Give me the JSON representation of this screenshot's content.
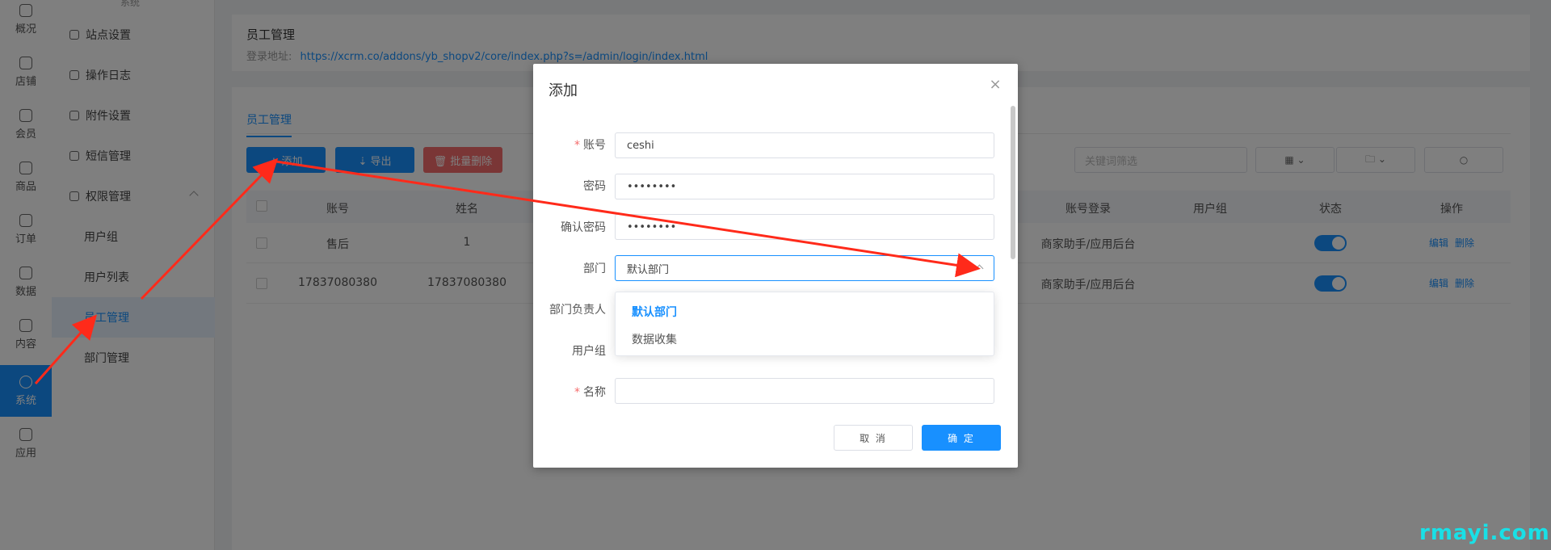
{
  "rail": {
    "items": [
      {
        "label": "概况",
        "icon": "dashboard-icon"
      },
      {
        "label": "店铺",
        "icon": "shop-icon"
      },
      {
        "label": "会员",
        "icon": "member-icon"
      },
      {
        "label": "商品",
        "icon": "goods-icon"
      },
      {
        "label": "订单",
        "icon": "order-icon"
      },
      {
        "label": "数据",
        "icon": "data-icon"
      },
      {
        "label": "内容",
        "icon": "content-icon"
      },
      {
        "label": "系统",
        "icon": "system-gear-icon"
      },
      {
        "label": "应用",
        "icon": "app-icon"
      }
    ],
    "active": "系统"
  },
  "submenu": {
    "top_label": "系统",
    "items": [
      {
        "label": "站点设置",
        "icon": "site-icon"
      },
      {
        "label": "操作日志",
        "icon": "log-icon"
      },
      {
        "label": "附件设置",
        "icon": "attachment-icon"
      },
      {
        "label": "短信管理",
        "icon": "sms-icon"
      },
      {
        "label": "权限管理",
        "icon": "permission-icon"
      },
      {
        "label": "用户组"
      },
      {
        "label": "用户列表"
      },
      {
        "label": "员工管理"
      },
      {
        "label": "部门管理"
      }
    ],
    "active": "员工管理"
  },
  "header": {
    "title": "员工管理",
    "url_label": "登录地址:",
    "url": "https://xcrm.co/addons/yb_shopv2/core/index.php?s=/admin/login/index.html"
  },
  "main": {
    "tab": "员工管理",
    "toolbar": {
      "add_label": "+ 添加",
      "export_label": "⇣ 导出",
      "batch_delete_label": "🗑 批量删除",
      "search_placeholder": "关键词筛选",
      "grid_label": "▦ ⌄",
      "folder_label": "🗀 ⌄",
      "search_icon_label": "○"
    },
    "table": {
      "columns": [
        "账号",
        "姓名",
        "账号登录",
        "用户组",
        "状态",
        "操作"
      ],
      "rows": [
        {
          "account": "售后",
          "name": "1",
          "login": "商家助手/应用后台",
          "group": "",
          "status": "on",
          "ops": [
            "编辑",
            "删除"
          ]
        },
        {
          "account": "17837080380",
          "name": "17837080380",
          "login": "商家助手/应用后台",
          "group": "",
          "status": "on",
          "ops": [
            "编辑",
            "删除"
          ]
        }
      ]
    }
  },
  "modal": {
    "title": "添加",
    "close": "×",
    "fields": {
      "account": {
        "label": "账号",
        "required": true,
        "value": "ceshi"
      },
      "password": {
        "label": "密码",
        "value": "••••••••"
      },
      "confirm_password": {
        "label": "确认密码",
        "value": "••••••••"
      },
      "department": {
        "label": "部门",
        "value": "默认部门"
      },
      "dept_leader": {
        "label": "部门负责人"
      },
      "user_group": {
        "label": "用户组"
      },
      "name": {
        "label": "名称",
        "required": true,
        "value": ""
      }
    },
    "dropdown_options": [
      "默认部门",
      "数据收集"
    ],
    "dropdown_selected": "默认部门",
    "cancel_label": "取 消",
    "ok_label": "确 定"
  },
  "watermark": "rmayi.com",
  "colors": {
    "primary": "#1890ff",
    "danger": "#f56c6c",
    "annotation_arrow": "#ff2a1a",
    "watermark": "#19e0e6"
  }
}
